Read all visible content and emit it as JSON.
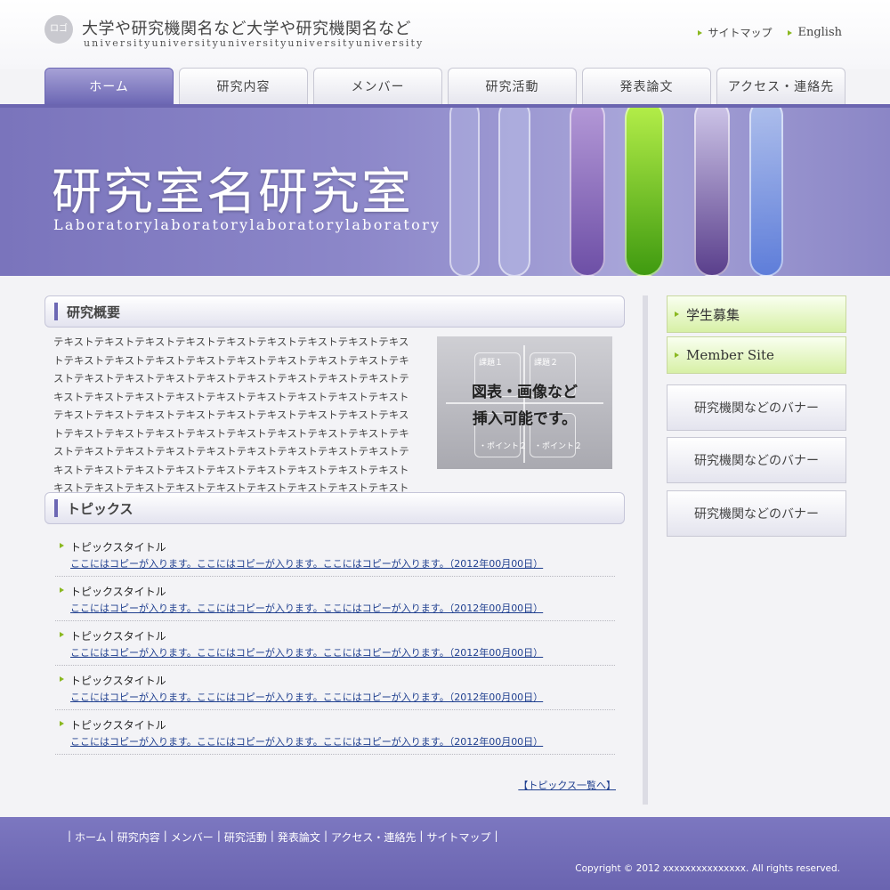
{
  "header": {
    "logo_text": "ロゴ",
    "title": "大学や研究機関名など大学や研究機関名など",
    "subtitle": "universityuniversityuniversityuniversityuniversity",
    "util_links": [
      "サイトマップ",
      "English"
    ]
  },
  "nav": {
    "tabs": [
      {
        "label": "ホーム",
        "active": true
      },
      {
        "label": "研究内容"
      },
      {
        "label": "メンバー"
      },
      {
        "label": "研究活動"
      },
      {
        "label": "発表論文"
      },
      {
        "label": "アクセス・連絡先"
      }
    ]
  },
  "hero": {
    "title": "研究室名研究室",
    "subtitle": "Laboratorylaboratorylaboratorylaboratory"
  },
  "overview": {
    "heading": "研究概要",
    "text": "テキストテキストテキストテキストテキストテキストテキストテキストテキストテキストテキストテキストテキストテキストテキストテキストテキストテキストテキストテキストテキストテキストテキストテキストテキストテキストテキストテキストテキストテキストテキストテキストテキストテキストテキストテキストテキストテキストテキストテキストテキストテキストテキストテキストテキストテキストテキストテキストテキストテキストテキストテキストテキストテキストテキストテキストテキストテキストテキストテキストテキストテキストテキストテキストテキストテキストテキストテキストテキストテキストキストテキストテキストテキストテキストテキストテキストテキストテキスト",
    "image_caption_1": "図表・画像など",
    "image_caption_2": "挿入可能です。",
    "image_labels": [
      "課題１",
      "課題２",
      "・ポイント１",
      "・ポイント２"
    ]
  },
  "topics": {
    "heading": "トピックス",
    "items": [
      {
        "title": "トピックスタイトル",
        "link": "ここにはコピーが入ります。ここにはコピーが入ります。ここにはコピーが入ります。（2012年00月00日）"
      },
      {
        "title": "トピックスタイトル",
        "link": "ここにはコピーが入ります。ここにはコピーが入ります。ここにはコピーが入ります。（2012年00月00日）"
      },
      {
        "title": "トピックスタイトル",
        "link": "ここにはコピーが入ります。ここにはコピーが入ります。ここにはコピーが入ります。（2012年00月00日）"
      },
      {
        "title": "トピックスタイトル",
        "link": "ここにはコピーが入ります。ここにはコピーが入ります。ここにはコピーが入ります。（2012年00月00日）"
      },
      {
        "title": "トピックスタイトル",
        "link": "ここにはコピーが入ります。ここにはコピーが入ります。ここにはコピーが入ります。（2012年00月00日）"
      }
    ],
    "more_link": "【トピックス一覧へ】"
  },
  "sidebar": {
    "green_links": [
      "学生募集",
      "Member Site"
    ],
    "banners": [
      "研究機関などのバナー",
      "研究機関などのバナー",
      "研究機関などのバナー"
    ]
  },
  "footer": {
    "nav": [
      "ホーム",
      "研究内容",
      "メンバー",
      "研究活動",
      "発表論文",
      "アクセス・連絡先",
      "サイトマップ"
    ],
    "separator": "|",
    "copyright": "Copyright © 2012 xxxxxxxxxxxxxxx. All rights reserved."
  },
  "colors": {
    "accent_purple": "#6c67b4",
    "green_arrow": "#8ab820",
    "link_blue": "#1f3f8f"
  }
}
